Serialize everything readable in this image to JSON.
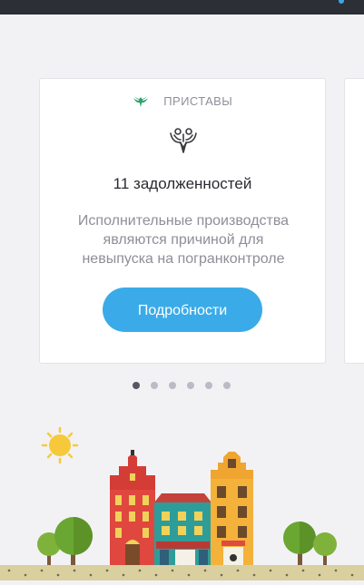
{
  "card": {
    "source_label": "ПРИСТАВЫ",
    "source_icon": "bailiff-emblem-icon",
    "emblem_icon": "double-headed-eagle-icon",
    "count_text": "11 задолженностей",
    "description_lines": [
      "Исполнительные производства",
      "являются причиной для",
      "невыпуска на погранконтроле"
    ],
    "button_label": "Подробности"
  },
  "pager": {
    "total": 6,
    "active_index": 0
  },
  "colors": {
    "accent": "#3aabe8",
    "brand_green": "#2aa36b",
    "background": "#f2f2f4"
  }
}
